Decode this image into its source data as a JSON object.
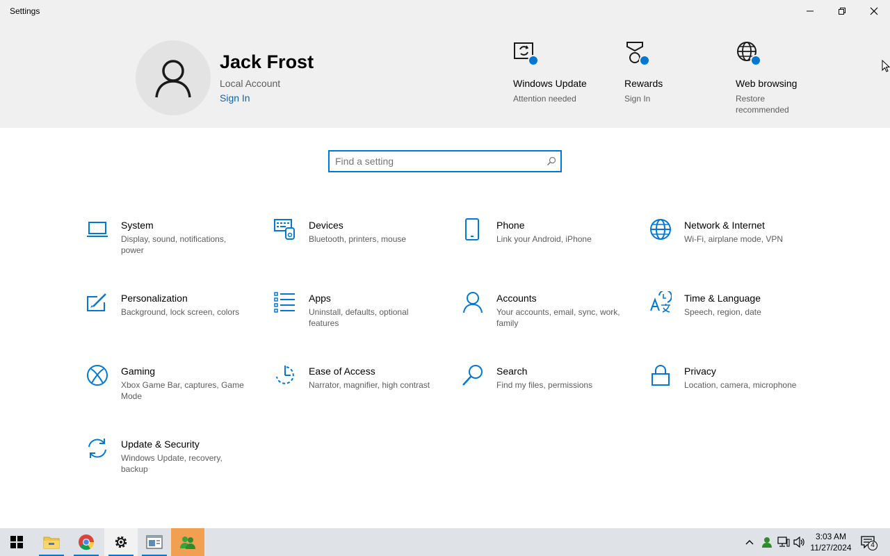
{
  "window": {
    "title": "Settings"
  },
  "profile": {
    "name": "Jack Frost",
    "account_type": "Local Account",
    "sign_in": "Sign In"
  },
  "status": [
    {
      "icon": "windows-update-icon",
      "title": "Windows Update",
      "subtitle": "Attention needed"
    },
    {
      "icon": "rewards-icon",
      "title": "Rewards",
      "subtitle": "Sign In"
    },
    {
      "icon": "web-browsing-icon",
      "title": "Web browsing",
      "subtitle": "Restore recommended"
    }
  ],
  "search": {
    "placeholder": "Find a setting",
    "value": ""
  },
  "categories": [
    {
      "icon": "laptop-icon",
      "title": "System",
      "desc": "Display, sound, notifications, power"
    },
    {
      "icon": "keyboard-icon",
      "title": "Devices",
      "desc": "Bluetooth, printers, mouse"
    },
    {
      "icon": "phone-icon",
      "title": "Phone",
      "desc": "Link your Android, iPhone"
    },
    {
      "icon": "globe-icon",
      "title": "Network & Internet",
      "desc": "Wi-Fi, airplane mode, VPN"
    },
    {
      "icon": "paint-icon",
      "title": "Personalization",
      "desc": "Background, lock screen, colors"
    },
    {
      "icon": "apps-list-icon",
      "title": "Apps",
      "desc": "Uninstall, defaults, optional features"
    },
    {
      "icon": "person-icon",
      "title": "Accounts",
      "desc": "Your accounts, email, sync, work, family"
    },
    {
      "icon": "time-language-icon",
      "title": "Time & Language",
      "desc": "Speech, region, date"
    },
    {
      "icon": "xbox-icon",
      "title": "Gaming",
      "desc": "Xbox Game Bar, captures, Game Mode"
    },
    {
      "icon": "ease-of-access-icon",
      "title": "Ease of Access",
      "desc": "Narrator, magnifier, high contrast"
    },
    {
      "icon": "search-icon",
      "title": "Search",
      "desc": "Find my files, permissions"
    },
    {
      "icon": "lock-icon",
      "title": "Privacy",
      "desc": "Location, camera, microphone"
    },
    {
      "icon": "sync-icon",
      "title": "Update & Security",
      "desc": "Windows Update, recovery, backup"
    }
  ],
  "taskbar": {
    "apps": [
      "start-icon",
      "file-explorer-icon",
      "chrome-icon",
      "settings-gear-icon",
      "app-window-icon",
      "people-app-icon"
    ],
    "clock_time": "3:03 AM",
    "clock_date": "11/27/2024",
    "notification_count": "4"
  },
  "colors": {
    "accent": "#0078d4",
    "header_bg": "#f0f0f0",
    "taskbar_bg": "#dfe3e8"
  }
}
